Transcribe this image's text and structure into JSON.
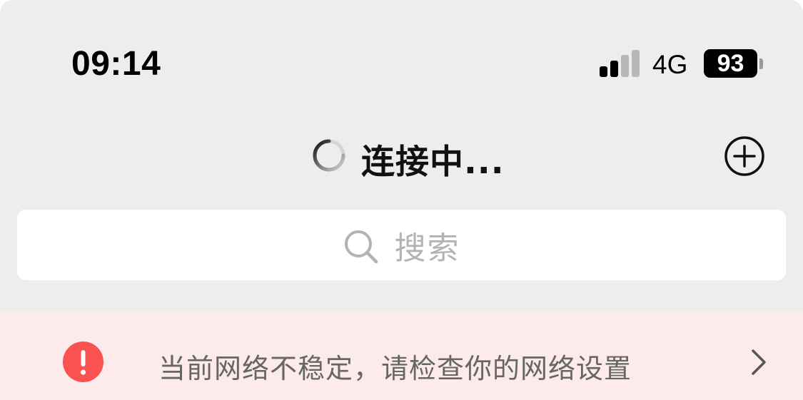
{
  "status_bar": {
    "time": "09:14",
    "signal_active_bars": 2,
    "signal_total_bars": 4,
    "network": "4G",
    "battery": "93"
  },
  "header": {
    "title": "连接中...",
    "spinner_icon": "loading-spinner-icon",
    "add_icon": "plus-circle-icon"
  },
  "search": {
    "placeholder": "搜索",
    "icon": "search-icon"
  },
  "network_warning": {
    "message": "当前网络不稳定，请检查你的网络设置",
    "icon_glyph": "!",
    "icon": "exclamation-circle-icon",
    "chevron": "chevron-right-icon"
  },
  "colors": {
    "background": "#ededed",
    "warning_background": "#fdeaea",
    "warning_icon": "#fa5151",
    "placeholder": "#b3b3b3"
  }
}
